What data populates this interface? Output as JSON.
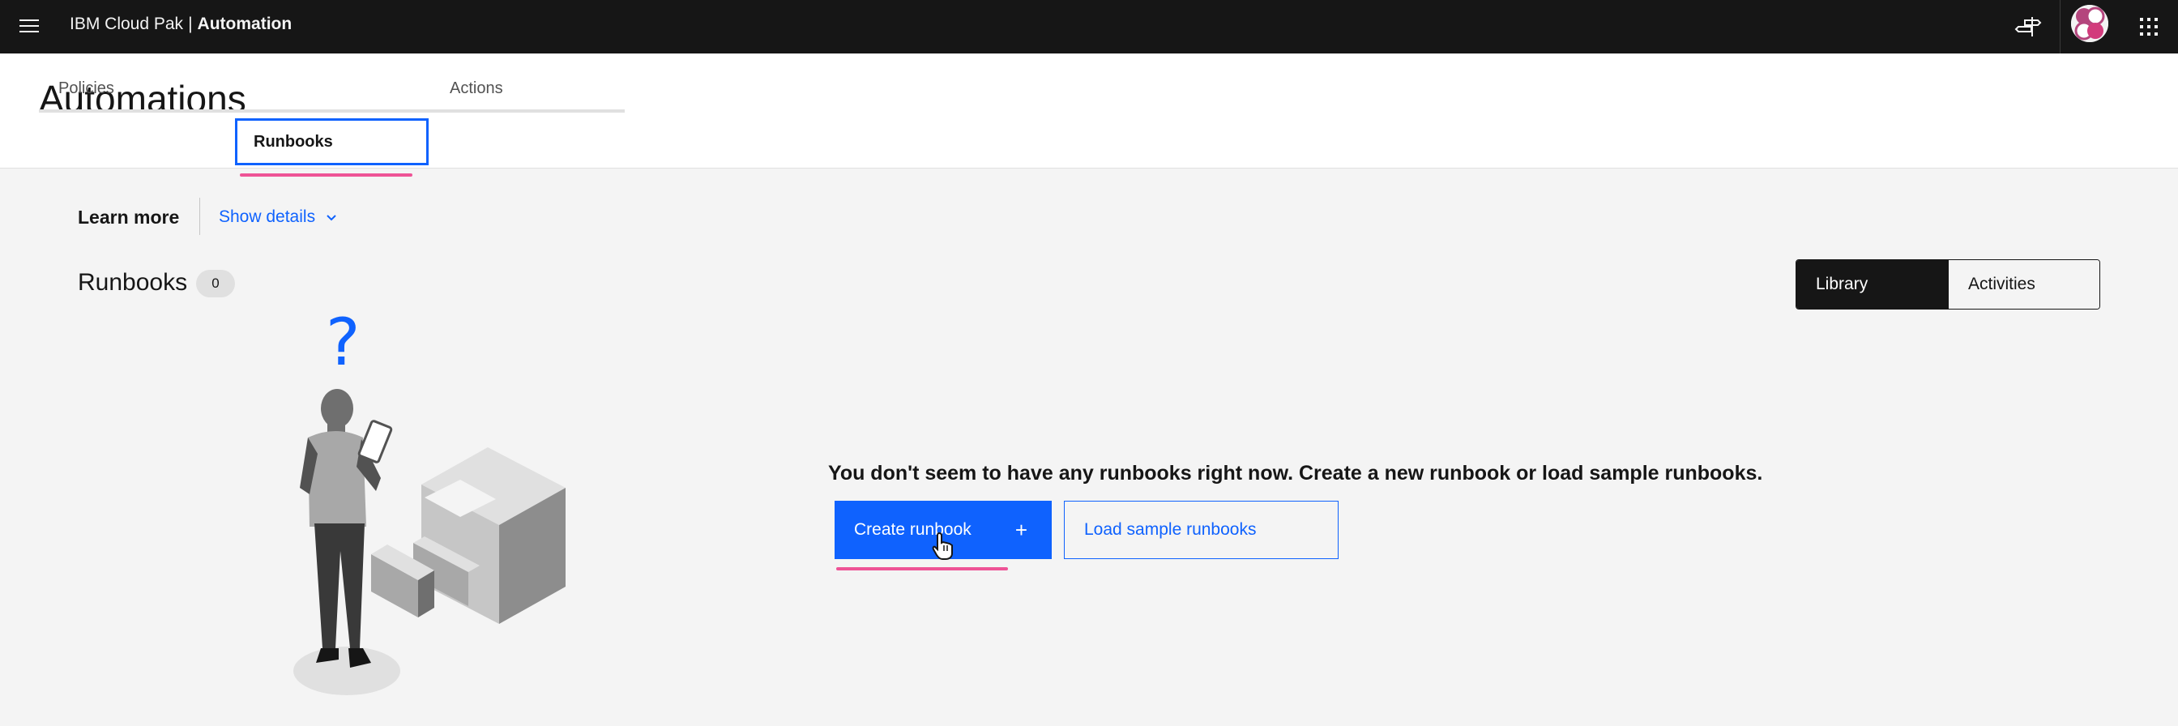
{
  "header": {
    "brand_name": "IBM Cloud Pak",
    "separator": "|",
    "product": "Automation",
    "icons": [
      "menu-icon",
      "signpost-icon",
      "avatar",
      "app-switcher-icon"
    ]
  },
  "page": {
    "title": "Automations",
    "tabs": [
      {
        "label": "Policies"
      },
      {
        "label": "Runbooks",
        "selected": true
      },
      {
        "label": "Actions"
      }
    ]
  },
  "learn_more": {
    "label": "Learn more",
    "toggle_label": "Show details"
  },
  "runbooks": {
    "heading": "Runbooks",
    "count": "0",
    "view_switcher": [
      {
        "label": "Library",
        "active": true
      },
      {
        "label": "Activities",
        "active": false
      }
    ]
  },
  "empty_state": {
    "message": "You don't seem to have any runbooks right now. Create a new runbook or load sample runbooks.",
    "primary_button": "Create runbook",
    "primary_icon": "+",
    "secondary_button": "Load sample runbooks"
  },
  "colors": {
    "accent": "#0f62fe",
    "header_bg": "#161616",
    "page_bg": "#f4f4f4",
    "highlight": "#ee5396"
  }
}
